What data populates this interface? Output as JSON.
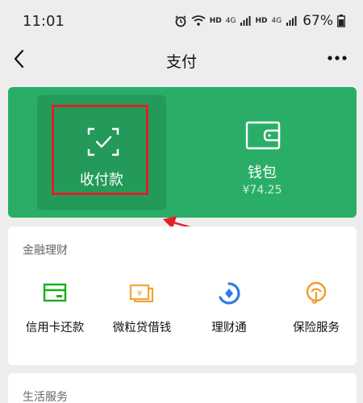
{
  "status_bar": {
    "time": "11:01",
    "hd1": "HD",
    "net1": "4G",
    "hd2": "HD",
    "net2": "4G",
    "battery": "67%"
  },
  "nav": {
    "title": "支付",
    "back_icon": "chevron-left-icon",
    "more_icon": "more-dots-icon"
  },
  "pay_card": {
    "receive_pay": {
      "label": "收付款",
      "icon": "scan-check-icon"
    },
    "wallet": {
      "label": "钱包",
      "balance": "¥74.25",
      "icon": "wallet-icon"
    }
  },
  "finance": {
    "title": "金融理财",
    "items": [
      {
        "label": "信用卡还款",
        "icon": "credit-card-icon",
        "color": "#1aad19"
      },
      {
        "label": "微粒贷借钱",
        "icon": "loan-icon",
        "color": "#f3a43b"
      },
      {
        "label": "理财通",
        "icon": "licaitong-icon",
        "color": "#2d7be5"
      },
      {
        "label": "保险服务",
        "icon": "insurance-icon",
        "color": "#f39a2e"
      }
    ]
  },
  "life_services": {
    "title": "生活服务"
  },
  "colors": {
    "green_card": "#2aae67",
    "pay_tile": "#249a5a",
    "annotation_red": "#e0202a",
    "page_bg": "#ededed"
  }
}
